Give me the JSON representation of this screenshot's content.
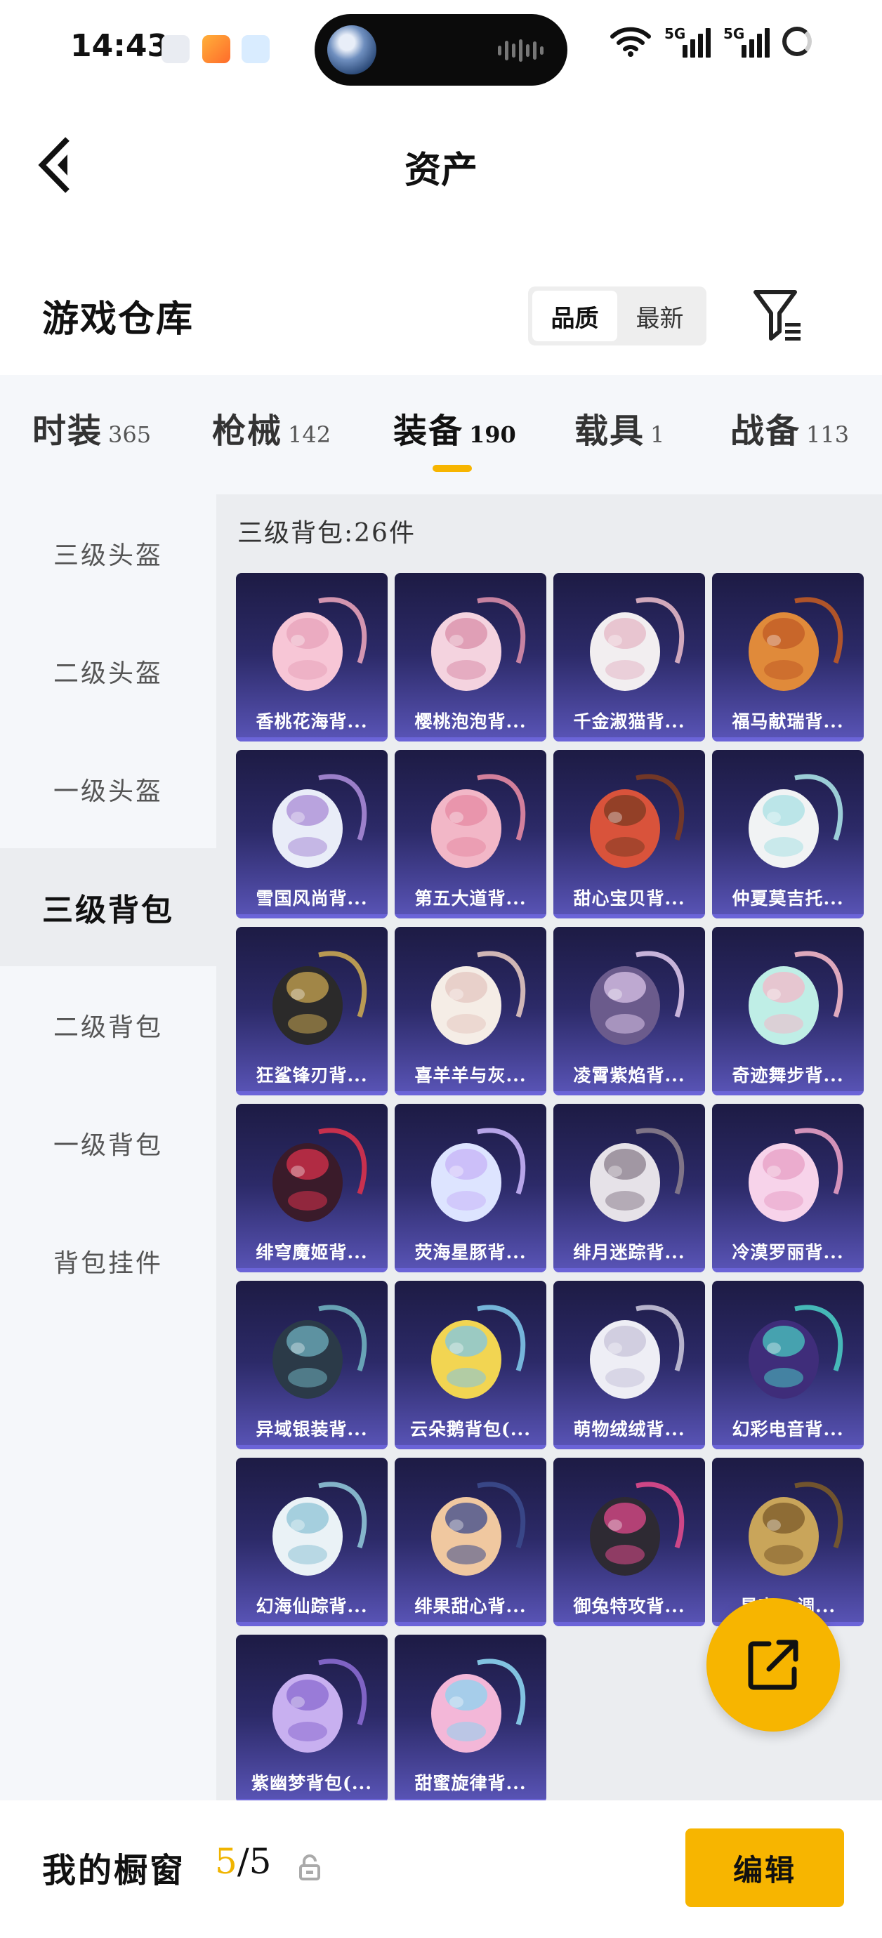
{
  "status_bar": {
    "time": "14:43",
    "network_1": "5G",
    "network_2": "5G"
  },
  "header": {
    "title": "资产"
  },
  "warehouse": {
    "title": "游戏仓库",
    "sort_options": [
      "品质",
      "最新"
    ],
    "selected_sort": "品质"
  },
  "tabs": [
    {
      "label": "时装",
      "count": "365"
    },
    {
      "label": "枪械",
      "count": "142"
    },
    {
      "label": "装备",
      "count": "190"
    },
    {
      "label": "载具",
      "count": "1"
    },
    {
      "label": "战备",
      "count": "113"
    }
  ],
  "active_tab": "装备",
  "sidebar": {
    "items": [
      "三级头盔",
      "二级头盔",
      "一级头盔",
      "三级背包",
      "二级背包",
      "一级背包",
      "背包挂件"
    ],
    "active": "三级背包"
  },
  "content": {
    "heading": "三级背包:26件",
    "items": [
      {
        "name": "香桃花海背...",
        "icon": "pink-bow-backpack"
      },
      {
        "name": "樱桃泡泡背...",
        "icon": "pink-bow-backpack"
      },
      {
        "name": "千金淑猫背...",
        "icon": "white-round-backpack"
      },
      {
        "name": "福马献瑞背...",
        "icon": "horse-backpack"
      },
      {
        "name": "雪国风尚背...",
        "icon": "penguin-backpack"
      },
      {
        "name": "第五大道背...",
        "icon": "pink-quilted-backpack"
      },
      {
        "name": "甜心宝贝背...",
        "icon": "cake-backpack"
      },
      {
        "name": "仲夏莫吉托...",
        "icon": "white-backpack"
      },
      {
        "name": "狂鲨锋刃背...",
        "icon": "shark-backpack"
      },
      {
        "name": "喜羊羊与灰...",
        "icon": "sheep-backpack"
      },
      {
        "name": "凌霄紫焰背...",
        "icon": "purple-flame-backpack"
      },
      {
        "name": "奇迹舞步背...",
        "icon": "winged-backpack"
      },
      {
        "name": "绯穹魔姬背...",
        "icon": "demon-backpack"
      },
      {
        "name": "荧海星豚背...",
        "icon": "dolphin-backpack"
      },
      {
        "name": "绯月迷踪背...",
        "icon": "bunny-backpack"
      },
      {
        "name": "冷漠罗丽背...",
        "icon": "heart-backpack"
      },
      {
        "name": "异域银装背...",
        "icon": "tactical-backpack"
      },
      {
        "name": "云朵鹅背包(...",
        "icon": "duck-backpack"
      },
      {
        "name": "萌物绒绒背...",
        "icon": "plush-backpack"
      },
      {
        "name": "幻彩电音背...",
        "icon": "speaker-backpack"
      },
      {
        "name": "幻海仙踪背...",
        "icon": "crystal-backpack"
      },
      {
        "name": "绯果甜心背...",
        "icon": "doll-backpack"
      },
      {
        "name": "御兔特攻背...",
        "icon": "mask-backpack"
      },
      {
        "name": "星宇...调...",
        "icon": "gold-backpack"
      },
      {
        "name": "紫幽梦背包(...",
        "icon": "purple-dream-backpack"
      },
      {
        "name": "甜蜜旋律背...",
        "icon": "candy-backpack"
      }
    ]
  },
  "bottom_bar": {
    "label": "我的橱窗",
    "current": "5",
    "total": "/5",
    "edit_label": "编辑"
  },
  "colors": {
    "accent": "#f7b500",
    "card_top": "#1d1b44",
    "card_bottom": "#5a55b8"
  }
}
